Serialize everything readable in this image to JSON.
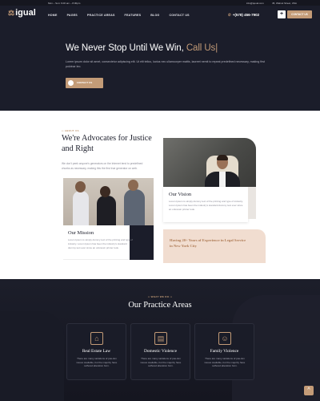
{
  "topbar": {
    "hours": "Mon – Sun: 9.00 am – 8.00pm",
    "email": "info@quual.com",
    "address": "45, Walnut Street, USA"
  },
  "header": {
    "logo": "igual",
    "nav": [
      "HOME",
      "PAGES",
      "PRACTICE AREAS",
      "FEATURES",
      "BLOG",
      "CONTACT US"
    ],
    "phone": "+(578) 456-7902",
    "plus_label": "+",
    "contact_button": "CONTACT US"
  },
  "hero": {
    "title_main": "We Never Stop Until We Win,",
    "title_accent": "Call Us",
    "text": "Lorem ipsum dolor sit amet, consectetur adipiscing elit. Ut elit tellus, luctus nec ullamcorper mattis, laoreet nemit to repeat predefined necessary, making first pulvinar leo.",
    "button": "CONTACT US"
  },
  "about": {
    "eyebrow": "ABOUT US",
    "title": "We're Advocates for Justice and Right",
    "text": "We don't peek anyone's generators on the Internet tend to predefined chunks as necessary, making this the first true generator on web.",
    "mission_title": "Our Mission",
    "mission_text": "Lorem Ipsum is simply dummy text of the printing and type of industry. Lorem Ipsum has been the industry's standard dummy text ever since an unknown printer took.",
    "vision_title": "Our Vision",
    "vision_text": "Lorem Ipsum is simply dummy text of the printing and type of industry. Lorem Ipsum has been the industry's standard dummy text ever since an unknown printer took.",
    "experience": "Having 20+ Years of Experience in Legal Service in New York City"
  },
  "practice": {
    "eyebrow": "WHAT WE DO",
    "title": "Our Practice Areas",
    "cards": [
      {
        "title": "Real Estate Law",
        "text": "There are many variations of pas-tion issues available, but the majority have suffered alteration form.",
        "icon": "house-icon"
      },
      {
        "title": "Domestic Violence",
        "text": "There are many variations of pas-tion issues available, but the majority have suffered alteration form.",
        "icon": "document-icon"
      },
      {
        "title": "Family Violence",
        "text": "There are many variations of pas-tion issues available, but the majority have suffered alteration form.",
        "icon": "family-icon"
      }
    ]
  },
  "scroll_top": "^",
  "colors": {
    "accent": "#c39b77",
    "dark": "#1b1d2a"
  }
}
